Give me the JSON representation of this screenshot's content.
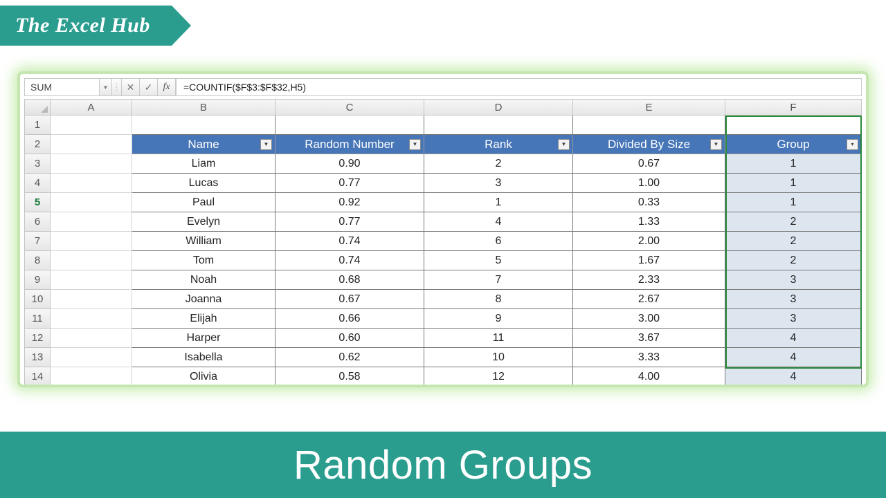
{
  "brand": {
    "title": "The Excel Hub"
  },
  "formulaBar": {
    "nameBox": "SUM",
    "formula": "=COUNTIF($F$3:$F$32,H5)",
    "fxLabel": "fx"
  },
  "columns": [
    "A",
    "B",
    "C",
    "D",
    "E",
    "F"
  ],
  "headerRow": {
    "B": "Name",
    "C": "Random Number",
    "D": "Rank",
    "E": "Divided By Size",
    "F": "Group"
  },
  "rowNumbers": [
    "1",
    "2",
    "3",
    "4",
    "5",
    "6",
    "7",
    "8",
    "9",
    "10",
    "11",
    "12",
    "13",
    "14"
  ],
  "activeRow": "5",
  "data": {
    "rows": [
      {
        "name": "Liam",
        "rand": "0.90",
        "rank": "2",
        "div": "0.67",
        "grp": "1"
      },
      {
        "name": "Lucas",
        "rand": "0.77",
        "rank": "3",
        "div": "1.00",
        "grp": "1"
      },
      {
        "name": "Paul",
        "rand": "0.92",
        "rank": "1",
        "div": "0.33",
        "grp": "1"
      },
      {
        "name": "Evelyn",
        "rand": "0.77",
        "rank": "4",
        "div": "1.33",
        "grp": "2"
      },
      {
        "name": "William",
        "rand": "0.74",
        "rank": "6",
        "div": "2.00",
        "grp": "2"
      },
      {
        "name": "Tom",
        "rand": "0.74",
        "rank": "5",
        "div": "1.67",
        "grp": "2"
      },
      {
        "name": "Noah",
        "rand": "0.68",
        "rank": "7",
        "div": "2.33",
        "grp": "3"
      },
      {
        "name": "Joanna",
        "rand": "0.67",
        "rank": "8",
        "div": "2.67",
        "grp": "3"
      },
      {
        "name": "Elijah",
        "rand": "0.66",
        "rank": "9",
        "div": "3.00",
        "grp": "3"
      },
      {
        "name": "Harper",
        "rand": "0.60",
        "rank": "11",
        "div": "3.67",
        "grp": "4"
      },
      {
        "name": "Isabella",
        "rand": "0.62",
        "rank": "10",
        "div": "3.33",
        "grp": "4"
      },
      {
        "name": "Olivia",
        "rand": "0.58",
        "rank": "12",
        "div": "4.00",
        "grp": "4"
      }
    ]
  },
  "footer": {
    "title": "Random Groups"
  },
  "icons": {
    "dropdown": "▼",
    "cancel": "✕",
    "accept": "✓",
    "sep": "⋮",
    "filter": "▼",
    "sortFilter": "▾"
  }
}
